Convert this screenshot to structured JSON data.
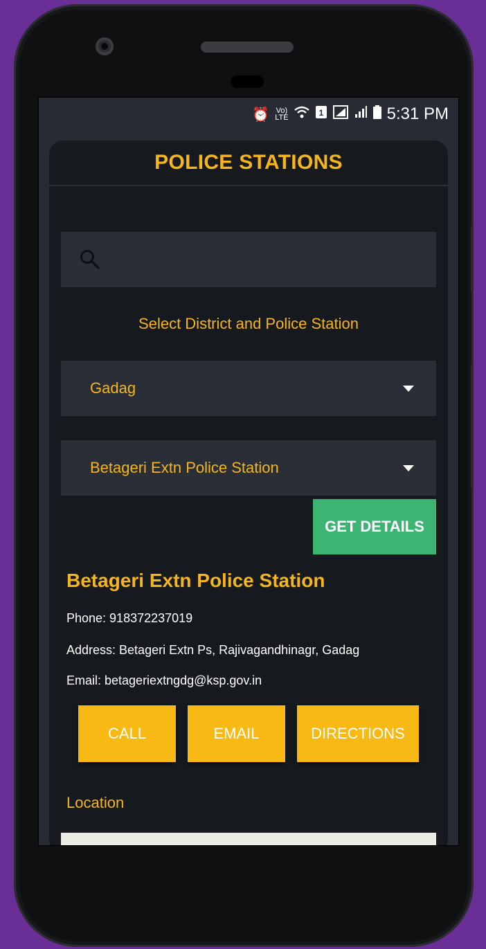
{
  "status_bar": {
    "time": "5:31 PM",
    "icons": [
      "alarm-icon",
      "volte-icon",
      "wifi-icon",
      "sim-icon",
      "signal-icon",
      "signal-icon",
      "battery-icon"
    ]
  },
  "header": {
    "title": "POLICE STATIONS"
  },
  "search": {
    "placeholder": "",
    "value": ""
  },
  "prompt": "Select District and Police Station",
  "district_select": {
    "value": "Gadag"
  },
  "station_select": {
    "value": "Betageri Extn Police Station"
  },
  "buttons": {
    "get_details": "GET DETAILS",
    "call": "CALL",
    "email": "EMAIL",
    "directions": "DIRECTIONS"
  },
  "details": {
    "name": "Betageri Extn Police Station",
    "phone": "Phone: 918372237019",
    "address": "Address: Betageri Extn Ps, Rajivagandhinagr, Gadag",
    "email": "Email: betageriextngdg@ksp.gov.in"
  },
  "location_label": "Location",
  "colors": {
    "accent": "#f5b51b",
    "action_button": "#f8b915",
    "get_details": "#3cb573",
    "card_bg": "#161a1e",
    "field_bg": "#2a2f37"
  }
}
